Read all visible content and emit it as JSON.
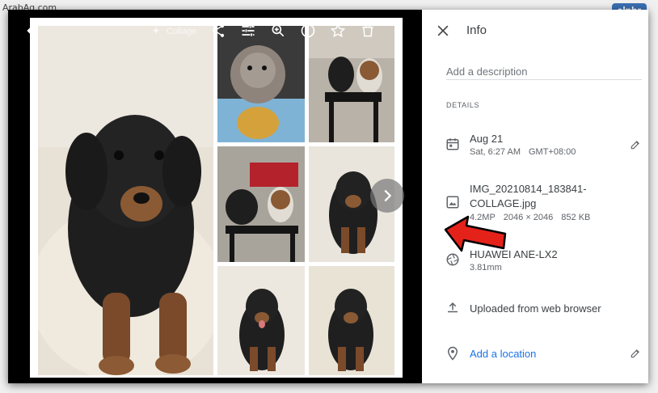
{
  "watermark": {
    "site": "ArabAq.com",
    "brand": "alphr"
  },
  "toolbar": {
    "collage_label": "Collage"
  },
  "info_panel": {
    "title": "Info",
    "description_placeholder": "Add a description",
    "details_label": "DETAILS",
    "date": {
      "primary": "Aug 21",
      "day_time": "Sat, 6:27 AM",
      "timezone": "GMT+08:00"
    },
    "file": {
      "name_line1": "IMG_20210814_183841-",
      "name_line2": "COLLAGE.jpg",
      "megapixels": "4.2MP",
      "dimensions": "2046 × 2046",
      "size": "852 KB"
    },
    "camera": {
      "model": "HUAWEI ANE-LX2",
      "focal": "3.81mm"
    },
    "upload": {
      "label": "Uploaded from web browser"
    },
    "location": {
      "label": "Add a location"
    }
  },
  "colors": {
    "link": "#1a73e8",
    "arrow": "#e5221a",
    "brand_badge": "#3a6fb4"
  },
  "icons": [
    "back-icon",
    "collage-sparkle-icon",
    "share-icon",
    "tune-icon",
    "zoom-in-icon",
    "info-icon",
    "star-icon",
    "trash-icon",
    "more-icon",
    "next-icon",
    "close-icon",
    "calendar-icon",
    "image-icon",
    "aperture-icon",
    "upload-icon",
    "location-pin-icon",
    "pencil-icon"
  ]
}
